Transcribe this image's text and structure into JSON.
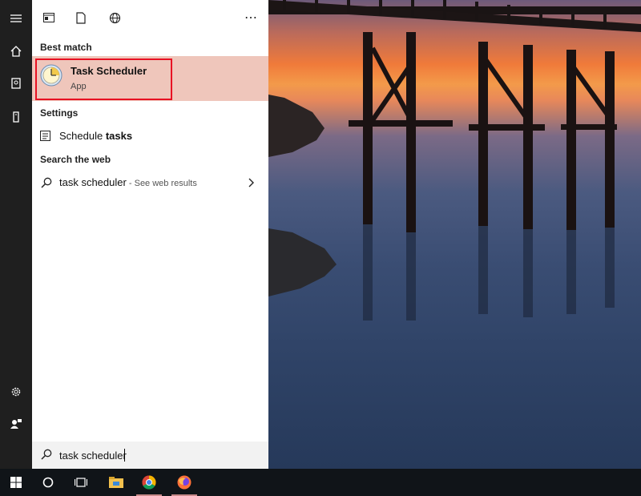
{
  "rail": {
    "items": [
      {
        "icon": "hamburger-menu-icon"
      },
      {
        "icon": "home-icon"
      },
      {
        "icon": "documents-icon"
      },
      {
        "icon": "tower-device-icon"
      },
      {
        "icon": "settings-gear-icon"
      },
      {
        "icon": "user-feedback-icon"
      }
    ]
  },
  "panel": {
    "toolbar": {
      "icons": [
        "apps-filter-icon",
        "documents-filter-icon",
        "web-filter-icon",
        "more-options-icon"
      ],
      "more_label": "⋯"
    },
    "best_match": {
      "heading": "Best match",
      "title": "Task Scheduler",
      "subtitle": "App",
      "icon": "task-scheduler-clock-icon"
    },
    "settings": {
      "heading": "Settings",
      "item_prefix": "Schedule ",
      "item_bold": "tasks"
    },
    "web": {
      "heading": "Search the web",
      "query": "task scheduler",
      "hint": " - See web results"
    },
    "search": {
      "value": "task scheduler"
    }
  },
  "taskbar": {
    "items": [
      {
        "icon": "windows-start-icon"
      },
      {
        "icon": "cortana-circle-icon"
      },
      {
        "icon": "task-view-icon"
      },
      {
        "icon": "file-explorer-icon"
      },
      {
        "icon": "chrome-icon"
      },
      {
        "icon": "firefox-icon"
      }
    ]
  },
  "colors": {
    "rail": "#1f1f1f",
    "highlight": "#efc6bb",
    "outline": "#e81123",
    "taskbar": "#101418"
  }
}
